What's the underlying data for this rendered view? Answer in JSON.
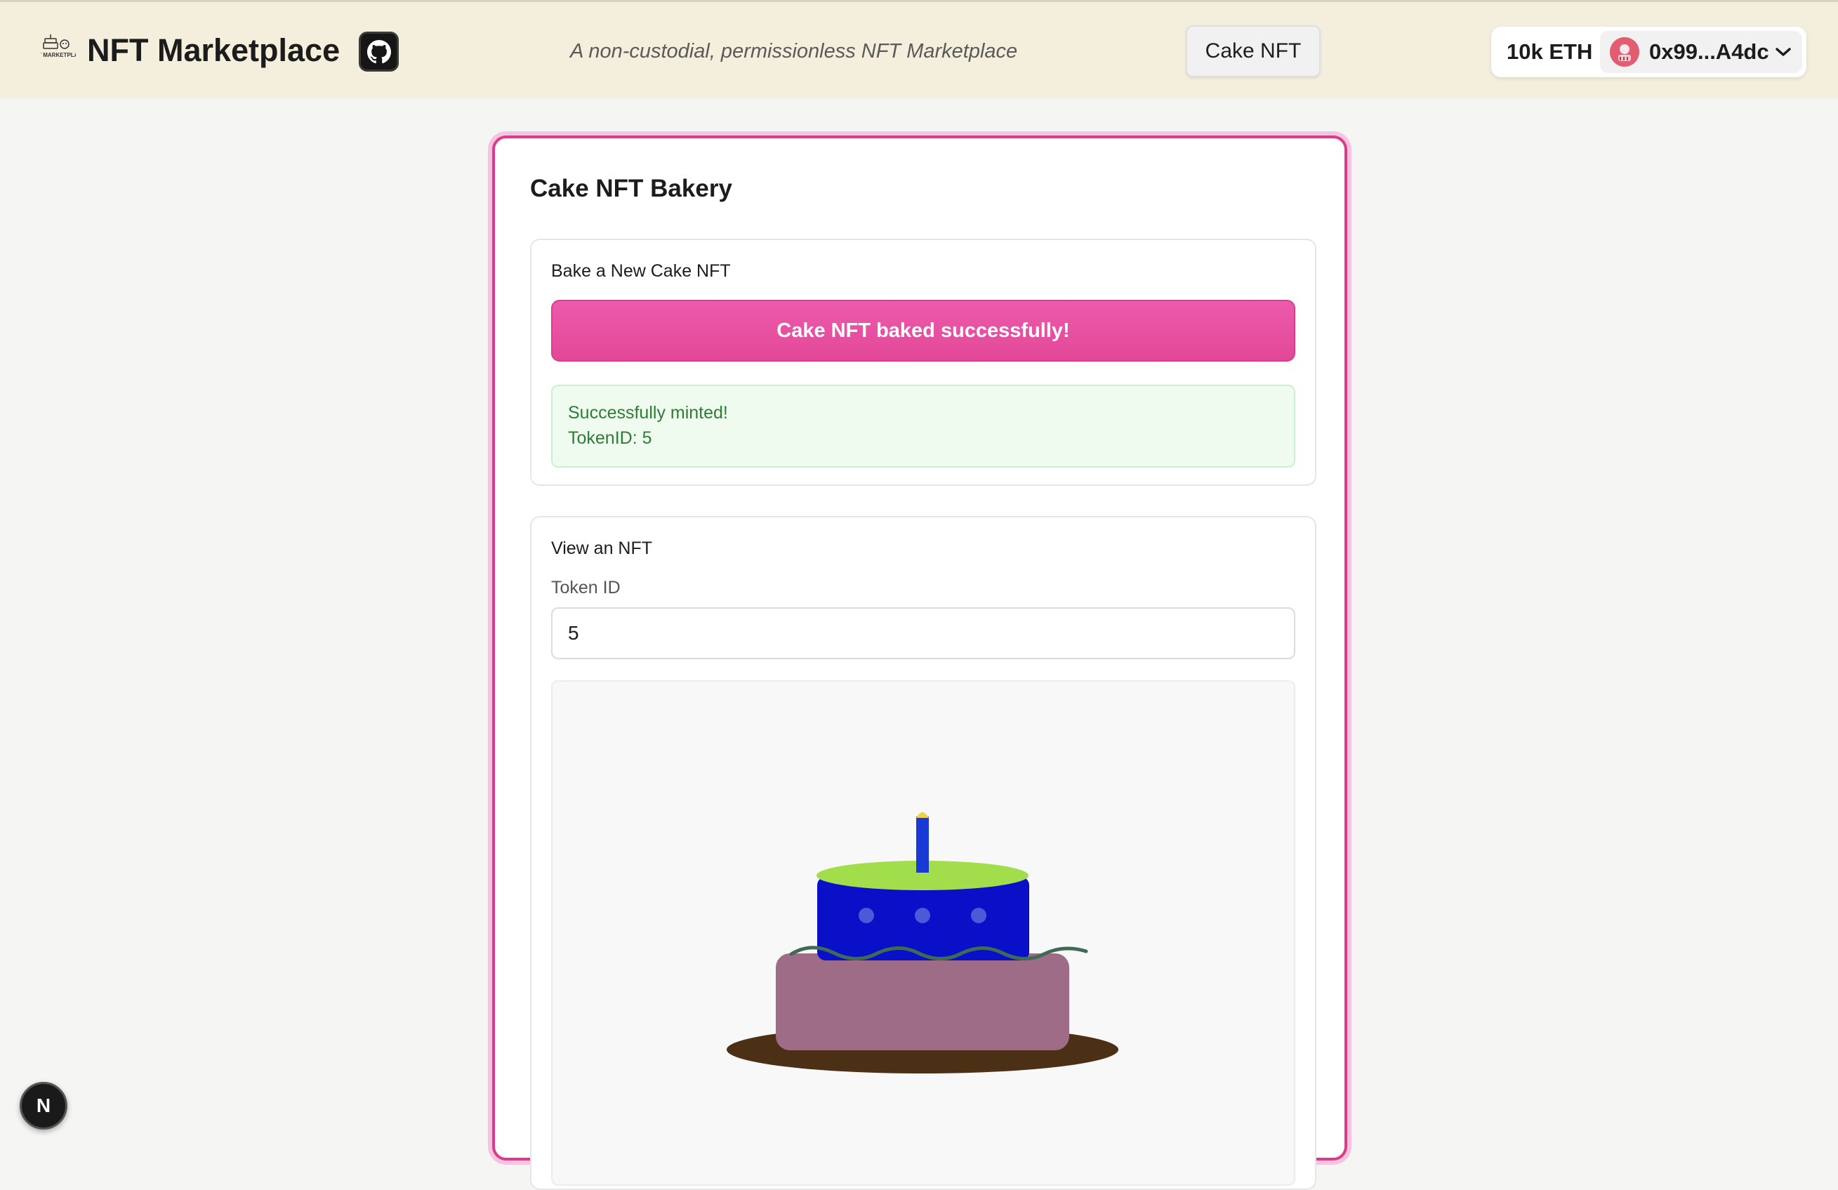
{
  "header": {
    "app_title": "NFT Marketplace",
    "logo_text": "NFT MARKETPLACE",
    "tagline": "A non-custodial, permissionless NFT Marketplace",
    "nav_button_label": "Cake NFT",
    "wallet": {
      "balance": "10k ETH",
      "address": "0x99...A4dc"
    }
  },
  "card": {
    "title": "Cake NFT Bakery",
    "bake_section": {
      "label": "Bake a New Cake NFT",
      "button_label": "Cake NFT baked successfully!",
      "success_message": "Successfully minted!",
      "token_line": "TokenID: 5"
    },
    "view_section": {
      "label": "View an NFT",
      "token_label": "Token ID",
      "token_value": "5"
    }
  },
  "dev_badge": {
    "label": "N"
  },
  "icons": {
    "logo": "nft-marketplace-logo-icon",
    "github": "github-icon",
    "avatar": "account-avatar-icon",
    "chevron": "chevron-down-icon"
  },
  "colors": {
    "header_bg": "#f4eedd",
    "accent_pink": "#e34898",
    "success_green": "#2e7d32",
    "cake_top": "#0a10c8",
    "cake_bottom": "#9e6c86",
    "icing": "#a2dd4b",
    "plate": "#4b3015"
  }
}
